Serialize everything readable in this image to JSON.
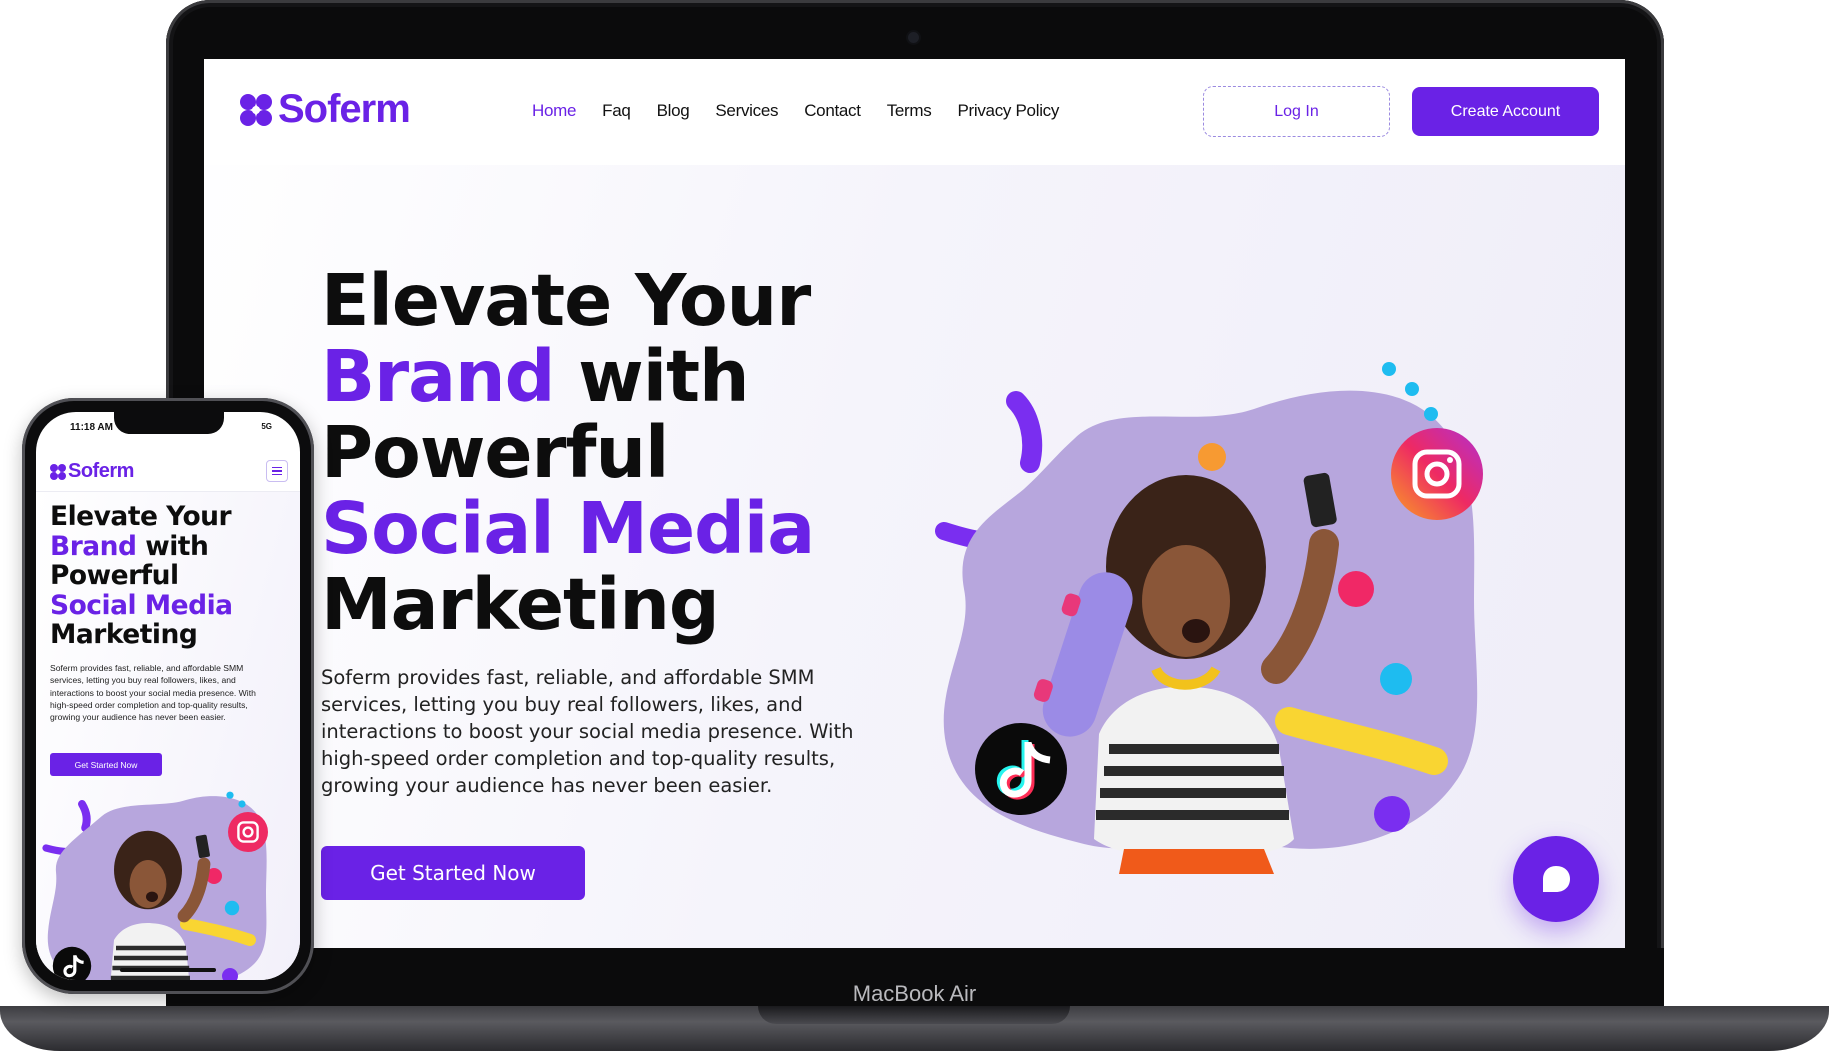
{
  "device_labels": {
    "laptop": "MacBook Air"
  },
  "site": {
    "brand": "Soferm",
    "nav": {
      "items": [
        "Home",
        "Faq",
        "Blog",
        "Services",
        "Contact",
        "Terms",
        "Privacy Policy"
      ],
      "active": "Home",
      "login_label": "Log In",
      "create_account_label": "Create Account"
    },
    "hero": {
      "title_lines": [
        {
          "parts": [
            {
              "text": "Elevate Your",
              "accent": false
            }
          ]
        },
        {
          "parts": [
            {
              "text": "Brand",
              "accent": true
            },
            {
              "text": " with",
              "accent": false
            }
          ]
        },
        {
          "parts": [
            {
              "text": "Powerful",
              "accent": false
            }
          ]
        },
        {
          "parts": [
            {
              "text": "Social Media",
              "accent": true
            }
          ]
        },
        {
          "parts": [
            {
              "text": "Marketing",
              "accent": false
            }
          ]
        }
      ],
      "description": "Soferm provides fast, reliable, and affordable SMM services, letting you buy real followers, likes, and interactions to boost your social media presence. With high-speed order completion and top-quality results, growing your audience has never been easier.",
      "cta_label": "Get Started Now"
    }
  },
  "phone": {
    "status": {
      "time": "11:18 AM",
      "signal": "5G"
    },
    "title_lines": [
      {
        "parts": [
          {
            "text": "Elevate Your",
            "accent": false
          }
        ]
      },
      {
        "parts": [
          {
            "text": "Brand",
            "accent": true
          },
          {
            "text": " with",
            "accent": false
          }
        ]
      },
      {
        "parts": [
          {
            "text": "Powerful",
            "accent": false
          }
        ]
      },
      {
        "parts": [
          {
            "text": "Social Media",
            "accent": true
          }
        ]
      },
      {
        "parts": [
          {
            "text": "Marketing",
            "accent": false
          }
        ]
      }
    ],
    "description": "Soferm provides fast, reliable, and affordable SMM services, letting you buy real followers, likes, and interactions to boost your social media presence. With high-speed order completion and top-quality results, growing your audience has never been easier.",
    "cta_label": "Get Started Now"
  },
  "icons": {
    "logo": "clover-logo-icon",
    "chat": "chat-bubble-icon",
    "instagram": "instagram-icon",
    "tiktok": "tiktok-icon",
    "menu": "hamburger-menu-icon"
  },
  "colors": {
    "brand_purple": "#6a22e6",
    "blob_lavender": "#b7a6dd",
    "accent_yellow": "#f9d532",
    "accent_blue": "#1ebcf0",
    "accent_pink": "#f02866",
    "accent_orange": "#f79a32"
  }
}
